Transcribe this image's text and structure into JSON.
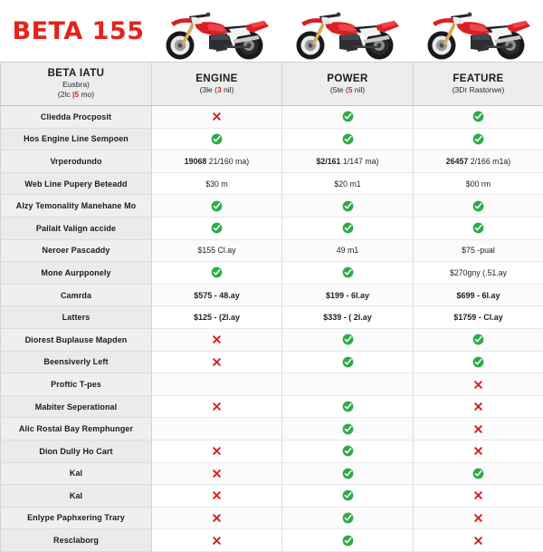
{
  "banner": {
    "brand_title": "BETA 155",
    "bike_image_alt": "red-dirt-bike-photo"
  },
  "table": {
    "headers": [
      {
        "main": "BETA IATU",
        "sub1": "Eusbra)",
        "sub2_pre": "(2lc ",
        "sub2_red": "|5",
        "sub2_post": " mo)"
      },
      {
        "main": "ENGINE",
        "sub1": "",
        "sub2_pre": "(3le (",
        "sub2_red": "3",
        "sub2_post": " nil)"
      },
      {
        "main": "POWER",
        "sub1": "",
        "sub2_pre": "(5te (",
        "sub2_red": "5",
        "sub2_post": " nil)"
      },
      {
        "main": "FEATURE",
        "sub1": "",
        "sub2_pre": "(3Dr Rastorwe)",
        "sub2_red": "",
        "sub2_post": ""
      }
    ],
    "rows": [
      {
        "label": "Cliedda Procposit",
        "cells": [
          {
            "type": "cross"
          },
          {
            "type": "check"
          },
          {
            "type": "check"
          }
        ]
      },
      {
        "label": "Hos Engine Line Sempoen",
        "cells": [
          {
            "type": "check"
          },
          {
            "type": "check"
          },
          {
            "type": "check"
          }
        ]
      },
      {
        "label": "Vrperodundo",
        "cells": [
          {
            "type": "text",
            "bold": "19068",
            "rest": " 21/160 ma)"
          },
          {
            "type": "text",
            "bold": "$2/161",
            "rest": " 1/147 ma)"
          },
          {
            "type": "text",
            "bold": "26457",
            "rest": " 2/166 m1a)"
          }
        ]
      },
      {
        "label": "Web Line Pupery Beteadd",
        "cells": [
          {
            "type": "text",
            "bold": "",
            "rest": "$30 m"
          },
          {
            "type": "text",
            "bold": "",
            "rest": "$20 m1"
          },
          {
            "type": "text",
            "bold": "",
            "rest": "$00 rm"
          }
        ]
      },
      {
        "label": "Alzy Temonality Manehane Mo",
        "cells": [
          {
            "type": "check"
          },
          {
            "type": "check"
          },
          {
            "type": "check"
          }
        ]
      },
      {
        "label": "Pailait Valign accide",
        "cells": [
          {
            "type": "check"
          },
          {
            "type": "check"
          },
          {
            "type": "check"
          }
        ]
      },
      {
        "label": "Neroer Pascaddy",
        "cells": [
          {
            "type": "text",
            "bold": "",
            "rest": "$155 Cl.ay"
          },
          {
            "type": "text",
            "bold": "",
            "rest": "49 m1"
          },
          {
            "type": "text",
            "bold": "",
            "rest": "$75 -pual"
          }
        ]
      },
      {
        "label": "Mone Aurpponely",
        "cells": [
          {
            "type": "check"
          },
          {
            "type": "check"
          },
          {
            "type": "text",
            "bold": "",
            "rest": "$270gny (.51.ay"
          }
        ]
      },
      {
        "label": "Camrda",
        "cells": [
          {
            "type": "price",
            "text": "$575 - 48.ay"
          },
          {
            "type": "price",
            "text": "$199 - 6l.ay"
          },
          {
            "type": "price",
            "text": "$699 - 6l.ay"
          }
        ]
      },
      {
        "label": "Latters",
        "cells": [
          {
            "type": "price",
            "text": "$125 - (2l.ay"
          },
          {
            "type": "price",
            "text": "$339 - ( 2l.ay"
          },
          {
            "type": "price",
            "text": "$1759 - Cl.ay"
          }
        ]
      },
      {
        "label": "Diorest Buplause Mapden",
        "cells": [
          {
            "type": "cross"
          },
          {
            "type": "check"
          },
          {
            "type": "check"
          }
        ]
      },
      {
        "label": "Beensiverly Left",
        "cells": [
          {
            "type": "cross"
          },
          {
            "type": "check"
          },
          {
            "type": "check"
          }
        ]
      },
      {
        "label": "Proftic T-pes",
        "cells": [
          {
            "type": "empty"
          },
          {
            "type": "empty"
          },
          {
            "type": "cross"
          }
        ]
      },
      {
        "label": "Mabiter Seperational",
        "cells": [
          {
            "type": "cross"
          },
          {
            "type": "check"
          },
          {
            "type": "cross"
          }
        ]
      },
      {
        "label": "Alic Rostal Bay Remphunger",
        "cells": [
          {
            "type": "empty"
          },
          {
            "type": "check"
          },
          {
            "type": "cross"
          }
        ]
      },
      {
        "label": "Dion Dully Ho Cart",
        "cells": [
          {
            "type": "cross"
          },
          {
            "type": "check"
          },
          {
            "type": "cross"
          }
        ]
      },
      {
        "label": "Kal",
        "cells": [
          {
            "type": "cross"
          },
          {
            "type": "check"
          },
          {
            "type": "check"
          }
        ]
      },
      {
        "label": "Kal",
        "cells": [
          {
            "type": "cross"
          },
          {
            "type": "check"
          },
          {
            "type": "cross"
          }
        ]
      },
      {
        "label": "Enlype Paphxering Trary",
        "cells": [
          {
            "type": "cross"
          },
          {
            "type": "check"
          },
          {
            "type": "cross"
          }
        ]
      },
      {
        "label": "Resclaborg",
        "cells": [
          {
            "type": "cross"
          },
          {
            "type": "check"
          },
          {
            "type": "cross"
          }
        ]
      }
    ]
  },
  "icons": {
    "check_name": "green-check-circle-icon",
    "cross_name": "red-cross-icon",
    "check_color": "#2eab46",
    "cross_color": "#d62121"
  },
  "colors": {
    "brand_red": "#e5231b",
    "header_bg": "#eceded",
    "label_bg": "#efefef"
  }
}
